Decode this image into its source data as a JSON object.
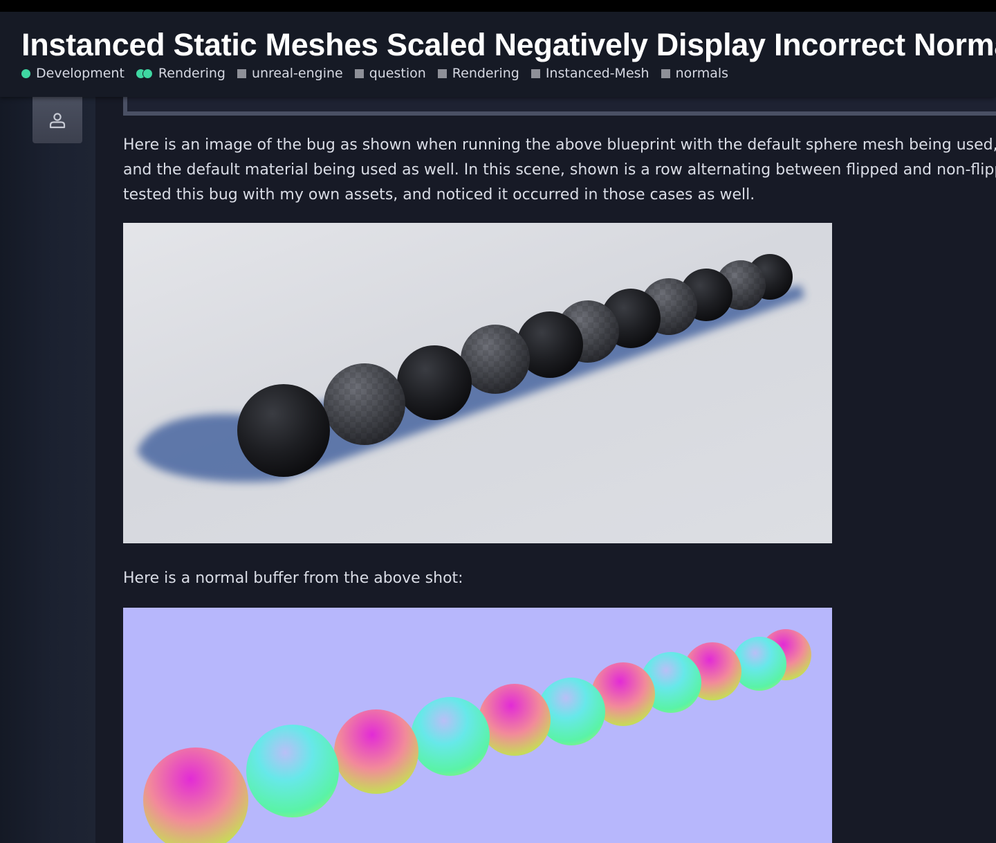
{
  "topic": {
    "title": "Instanced Static Meshes Scaled Negatively Display Incorrect Normals",
    "tags": [
      {
        "label": "Development",
        "style": "dot",
        "color": "#3fd7a2"
      },
      {
        "label": "Rendering",
        "style": "dual-dot",
        "color": "#3fd7a2"
      },
      {
        "label": "unreal-engine",
        "style": "square",
        "color": "#8e9098"
      },
      {
        "label": "question",
        "style": "square",
        "color": "#8e9098"
      },
      {
        "label": "Rendering",
        "style": "square",
        "color": "#8e9098"
      },
      {
        "label": "Instanced-Mesh",
        "style": "square",
        "color": "#8e9098"
      },
      {
        "label": "normals",
        "style": "square",
        "color": "#8e9098"
      }
    ]
  },
  "post": {
    "avatar_icon": "user-icon",
    "paragraph1_lines": [
      "Here is an image of the bug as shown when running the above blueprint with the default sphere mesh being used,",
      "and the default material being used as well. In this scene, shown is a row alternating between flipped and non-flipped",
      "tested this bug with my own assets, and noticed it occurred in those cases as well."
    ],
    "paragraph2": "Here is a normal buffer from the above shot:"
  },
  "theme": {
    "background": "#171a26",
    "header_background": "#161a25",
    "accent": "#3fd7a2",
    "normal_buffer_background": "#b7b7fc"
  }
}
